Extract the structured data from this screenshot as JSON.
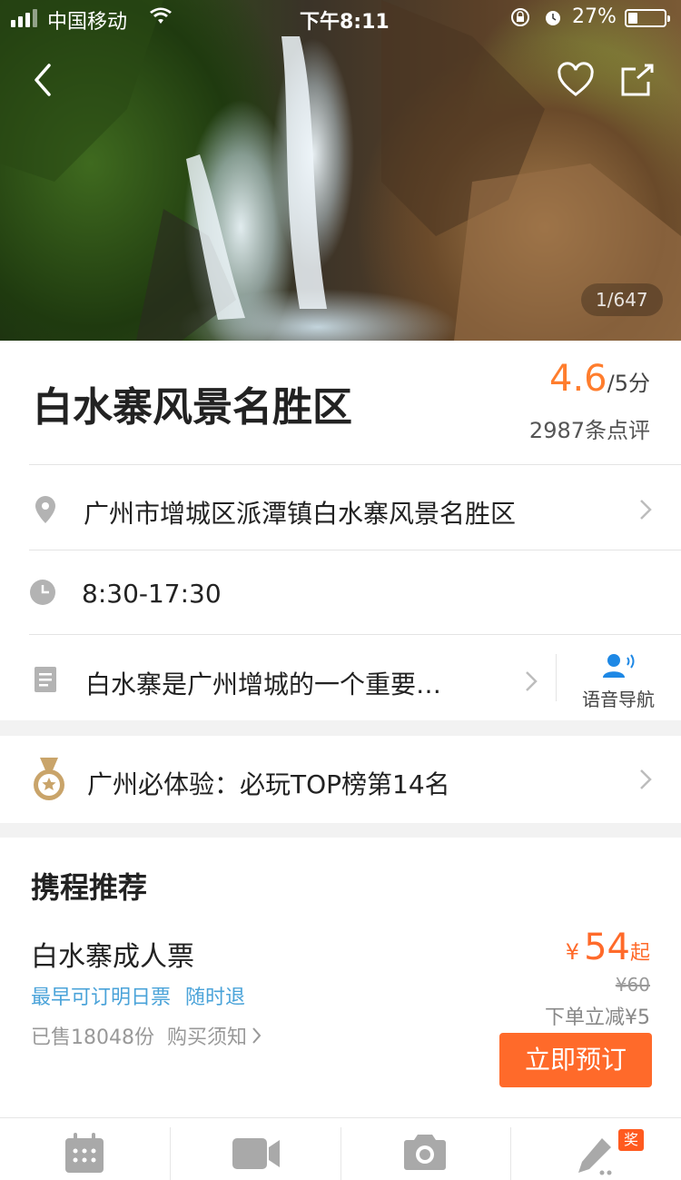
{
  "status_bar": {
    "carrier": "中国移动",
    "time": "下午8:11",
    "battery_percent": "27%",
    "battery_level": 0.27
  },
  "hero": {
    "photo_counter": "1/647"
  },
  "attraction": {
    "name": "白水寨风景名胜区",
    "rating_score": "4.6",
    "rating_max": "/5分",
    "review_count": "2987条点评"
  },
  "details": {
    "address": "广州市增城区派潭镇白水寨风景名胜区",
    "hours": "8:30-17:30",
    "intro": "白水寨是广州增城的一个重要…",
    "voice_guide_label": "语音导航"
  },
  "ranking": {
    "text": "广州必体验：必玩TOP榜第14名"
  },
  "recommend": {
    "section_title": "携程推荐",
    "ticket": {
      "name": "白水寨成人票",
      "tag_1": "最早可订明日票",
      "tag_2": "随时退",
      "sold": "已售18048份",
      "notice_link": "购买须知",
      "currency": "¥",
      "price": "54",
      "price_suffix": "起",
      "original_price": "¥60",
      "discount_note": "下单立减¥5",
      "book_label": "立即预订"
    }
  },
  "tabbar": {
    "reward_badge": "奖"
  },
  "icons": {
    "back": "chevron-left-icon",
    "favorite": "heart-icon",
    "share": "share-icon",
    "location": "location-pin-icon",
    "clock": "clock-icon",
    "intro": "document-icon",
    "voice": "voice-guide-icon",
    "medal": "medal-icon",
    "calendar": "calendar-icon",
    "video": "video-camera-icon",
    "camera": "camera-icon",
    "write": "pen-icon"
  },
  "colors": {
    "accent_orange": "#ff6a2a",
    "rating_orange": "#ff7d2d",
    "tag_blue": "#4aa3d9",
    "voice_blue": "#1e88e5",
    "medal_gold": "#c9a46a"
  }
}
